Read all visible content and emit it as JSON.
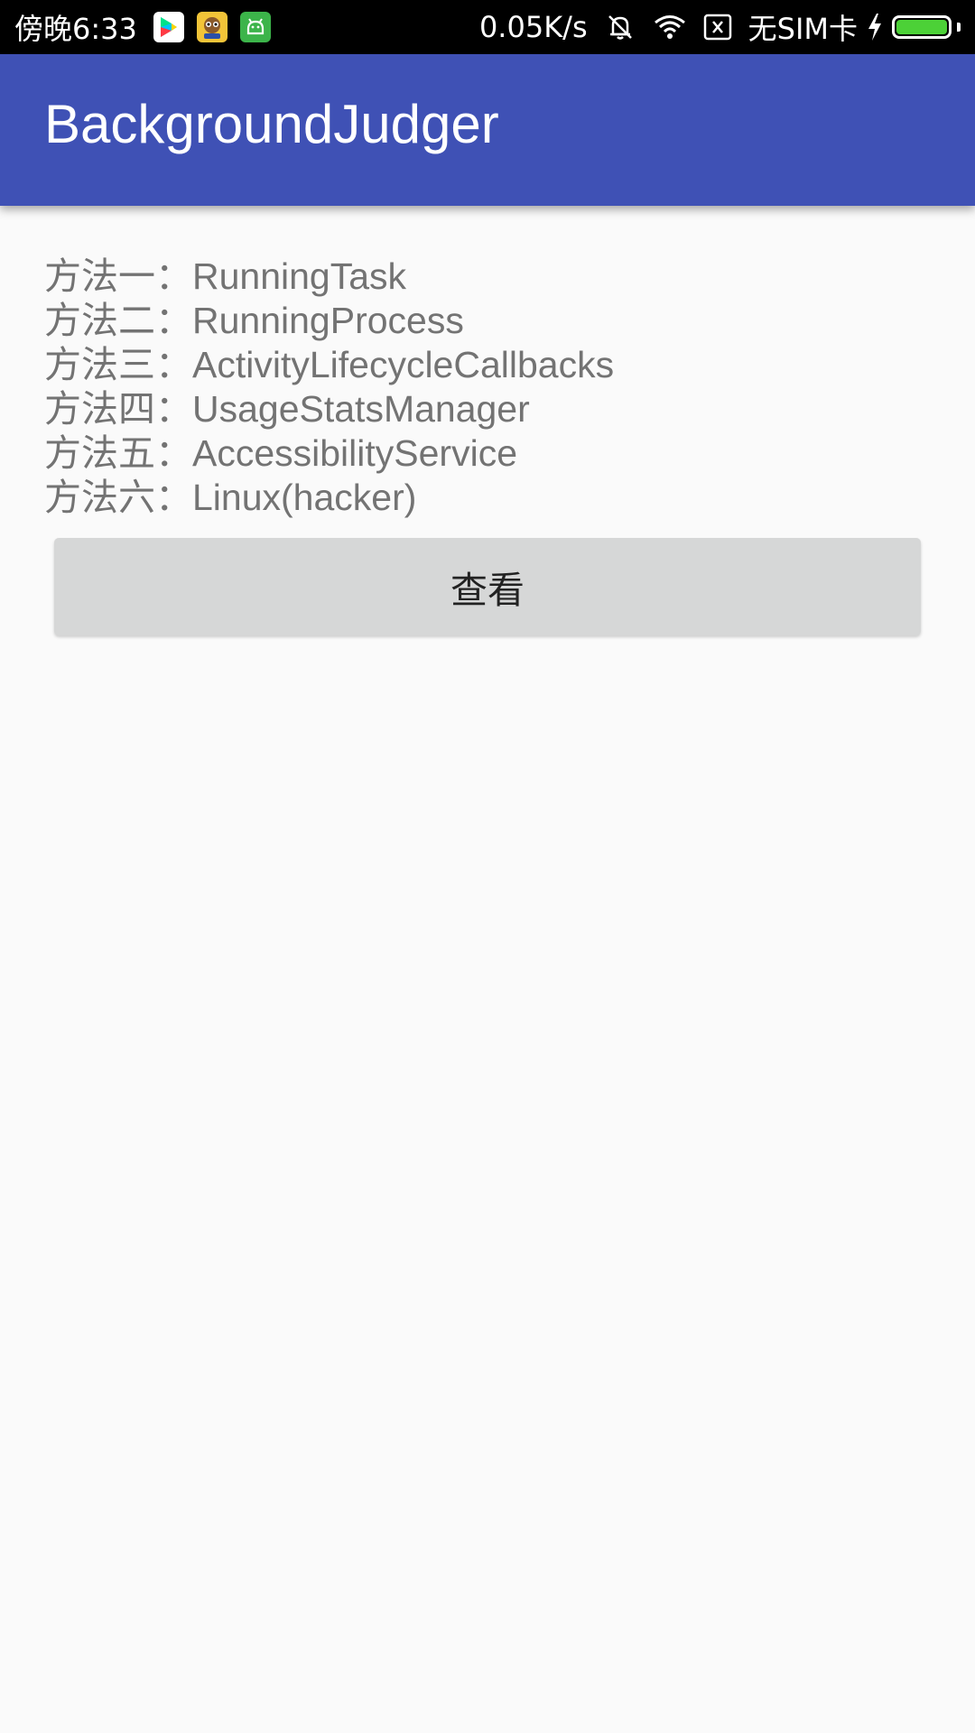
{
  "status_bar": {
    "time": "傍晚6:33",
    "net_speed": "0.05K/s",
    "carrier": "无SIM卡",
    "app_icons": [
      "play-store-icon",
      "game-app-icon",
      "android-green-icon"
    ],
    "status_icons": [
      "mute-bell-icon",
      "wifi-icon",
      "no-sim-icon",
      "charging-bolt-icon",
      "battery-icon"
    ],
    "battery_level": 1.0,
    "colors": {
      "background": "#000000",
      "battery": "#4cd137"
    }
  },
  "app_bar": {
    "title": "BackgroundJudger",
    "color": "#3f51b5"
  },
  "methods": [
    {
      "label": "方法一：RunningTask"
    },
    {
      "label": "方法二：RunningProcess"
    },
    {
      "label": "方法三：ActivityLifecycleCallbacks"
    },
    {
      "label": "方法四：UsageStatsManager"
    },
    {
      "label": "方法五：AccessibilityService"
    },
    {
      "label": "方法六：Linux(hacker)"
    }
  ],
  "view_button": {
    "label": "查看",
    "color": "#d6d7d7"
  }
}
